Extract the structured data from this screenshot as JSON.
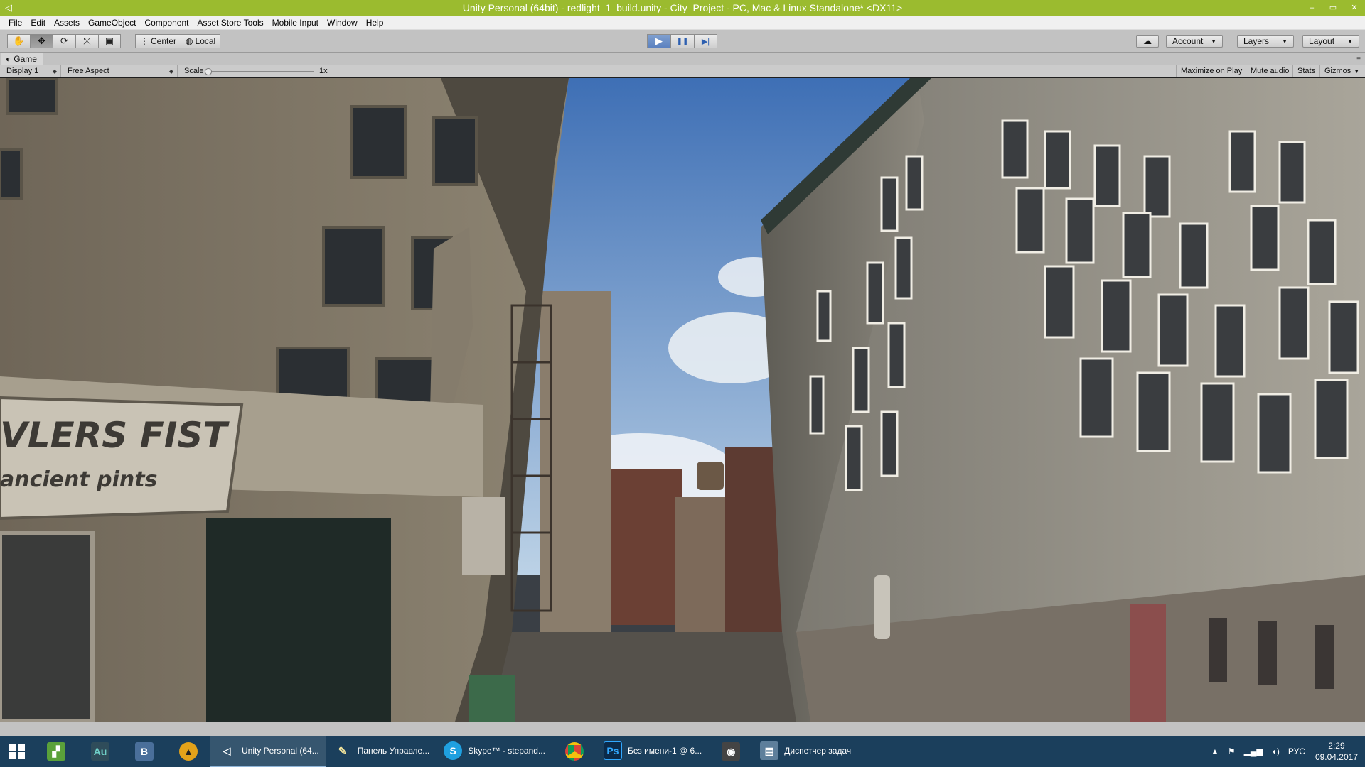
{
  "window": {
    "title": "Unity Personal (64bit) - redlight_1_build.unity - City_Project - PC, Mac & Linux Standalone* <DX11>",
    "minimize": "–",
    "maximize": "▭",
    "close": "✕"
  },
  "menu": [
    "File",
    "Edit",
    "Assets",
    "GameObject",
    "Component",
    "Asset Store Tools",
    "Mobile Input",
    "Window",
    "Help"
  ],
  "toolbar": {
    "tools": [
      {
        "name": "hand-tool-icon",
        "glyph": "✋",
        "active": false
      },
      {
        "name": "move-tool-icon",
        "glyph": "✥",
        "active": true
      },
      {
        "name": "rotate-tool-icon",
        "glyph": "⟳",
        "active": false
      },
      {
        "name": "scale-tool-icon",
        "glyph": "⤧",
        "active": false
      },
      {
        "name": "rect-tool-icon",
        "glyph": "▣",
        "active": false
      }
    ],
    "pivot_center": "Center",
    "pivot_local": "Local",
    "play_glyph": "▶",
    "pause_glyph": "❚❚",
    "step_glyph": "▶|",
    "cloud_glyph": "☁",
    "account": "Account",
    "layers": "Layers",
    "layout": "Layout"
  },
  "game_tab": {
    "label": "Game",
    "menu_glyph": "≡"
  },
  "game_toolbar": {
    "display": "Display 1",
    "aspect": "Free Aspect",
    "scale_label": "Scale",
    "scale_value": "1x",
    "scale_level": 0.0,
    "maximize_on_play": "Maximize on Play",
    "mute_audio": "Mute audio",
    "stats": "Stats",
    "gizmos": "Gizmos"
  },
  "scene": {
    "sign_line1": "VLERS FIST",
    "sign_line2": "ancient pints",
    "sky_top": "#3e6fb5",
    "sky_bottom": "#bcd2e6"
  },
  "taskbar": {
    "apps": [
      {
        "name": "taskbar-unity",
        "label": "Unity Personal (64...",
        "active": true
      },
      {
        "name": "taskbar-control-panel",
        "label": "Панель Управле...",
        "active": false
      },
      {
        "name": "taskbar-skype",
        "label": "Skype™ - stepand...",
        "active": false
      },
      {
        "name": "taskbar-photoshop",
        "label": "Без имени-1 @ 6...",
        "active": false
      },
      {
        "name": "taskbar-task-manager",
        "label": "Диспетчер задач",
        "active": false
      }
    ],
    "language": "РУС",
    "time": "2:29",
    "date": "09.04.2017"
  }
}
